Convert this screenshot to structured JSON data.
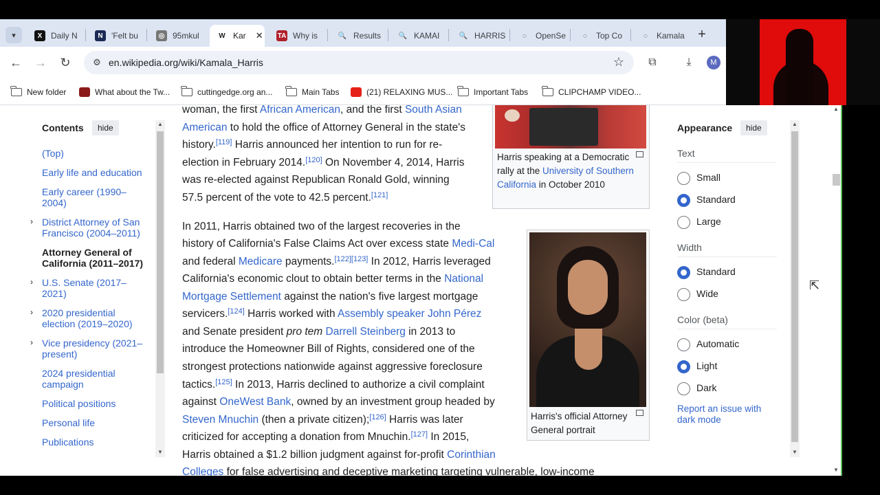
{
  "browser": {
    "tabs": [
      {
        "title": "Daily N",
        "fav_color": "#111111",
        "fav_char": "X"
      },
      {
        "title": "'Felt bu",
        "fav_color": "#1a2a55",
        "fav_char": "N"
      },
      {
        "title": "95mkul",
        "fav_color": "#777777",
        "fav_char": "◎"
      },
      {
        "title": "Kar",
        "fav_color": "#ffffff",
        "fav_char": "W",
        "active": true
      },
      {
        "title": "Why is",
        "fav_color": "#b0202a",
        "fav_char": "TA"
      },
      {
        "title": "Results",
        "fav_color": "#dde5f3",
        "fav_char": "🔍"
      },
      {
        "title": "KAMAI",
        "fav_color": "#dde5f3",
        "fav_char": "🔍"
      },
      {
        "title": "HARRIS",
        "fav_color": "#dde5f3",
        "fav_char": "🔍"
      },
      {
        "title": "OpenSe",
        "fav_color": "#dde5f3",
        "fav_char": "◌"
      },
      {
        "title": "Top Co",
        "fav_color": "#dde5f3",
        "fav_char": "◌"
      },
      {
        "title": "Kamala",
        "fav_color": "#dde5f3",
        "fav_char": "◌"
      }
    ],
    "tab_close": "✕",
    "new_tab": "+",
    "url": "en.wikipedia.org/wiki/Kamala_Harris",
    "avatar": "M",
    "bookmarks": [
      {
        "label": "New folder",
        "type": "folder"
      },
      {
        "label": "What about the Tw...",
        "type": "fav",
        "color": "#8b1a1a"
      },
      {
        "label": "cuttingedge.org an...",
        "type": "folder"
      },
      {
        "label": "Main Tabs",
        "type": "folder"
      },
      {
        "label": "(21) RELAXING MUS...",
        "type": "fav",
        "color": "#e62117"
      },
      {
        "label": "Important Tabs",
        "type": "folder"
      },
      {
        "label": "CLIPCHAMP VIDEO...",
        "type": "folder"
      }
    ]
  },
  "toc": {
    "title": "Contents",
    "hide": "hide",
    "items": [
      {
        "label": "(Top)"
      },
      {
        "label": "Early life and education"
      },
      {
        "label": "Early career (1990–2004)"
      },
      {
        "label": "District Attorney of San Francisco (2004–2011)",
        "chevron": "›"
      },
      {
        "label": "Attorney General of California (2011–2017)",
        "current": true
      },
      {
        "label": "U.S. Senate (2017–2021)",
        "chevron": "›"
      },
      {
        "label": "2020 presidential election (2019–2020)",
        "chevron": "›"
      },
      {
        "label": "Vice presidency (2021–present)",
        "chevron": "›"
      },
      {
        "label": "2024 presidential campaign"
      },
      {
        "label": "Political positions"
      },
      {
        "label": "Personal life"
      },
      {
        "label": "Publications"
      }
    ]
  },
  "article": {
    "p1": {
      "l1a": "woman, the first ",
      "l1b": "African American",
      "l1c": ", and the first ",
      "l1d": "South Asian",
      "l2a": "American",
      "l2b": " to hold the office of Attorney General in the state's",
      "l3a": "history.",
      "l3ref": "[119]",
      "l3b": " Harris announced her intention to run for re-",
      "l4a": "election in February 2014.",
      "l4ref": "[120]",
      "l4b": " On November 4, 2014, Harris",
      "l5": "was re-elected against Republican Ronald Gold, winning",
      "l6a": "57.5 percent of the vote to 42.5 percent.",
      "l6ref": "[121]"
    },
    "p2": {
      "l1": "In 2011, Harris obtained two of the largest recoveries in the",
      "l2a": "history of California's False Claims Act over excess state ",
      "l2b": "Medi-Cal",
      "l3a": "and federal ",
      "l3b": "Medicare",
      "l3c": " payments.",
      "l3ref": "[122][123]",
      "l3d": " In 2012, Harris leveraged",
      "l4a": "California's economic clout to obtain better terms in the ",
      "l4b": "National",
      "l5a": "Mortgage Settlement",
      "l5b": " against the nation's five largest mortgage",
      "l6a": "servicers.",
      "l6ref": "[124]",
      "l6b": " Harris worked with ",
      "l6c": "Assembly speaker John Pérez",
      "l7a": "and Senate president ",
      "l7b": "pro tem",
      "l7c": " ",
      "l7d": "Darrell Steinberg",
      "l7e": " in 2013 to",
      "l8": "introduce the Homeowner Bill of Rights, considered one of the",
      "l9": "strongest protections nationwide against aggressive foreclosure",
      "l10a": "tactics.",
      "l10ref": "[125]",
      "l10b": " In 2013, Harris declined to authorize a civil complaint",
      "l11a": "against ",
      "l11b": "OneWest Bank",
      "l11c": ", owned by an investment group headed by",
      "l12a": "Steven Mnuchin",
      "l12b": " (then a private citizen);",
      "l12ref": "[126]",
      "l12c": " Harris was later",
      "l13a": "criticized for accepting a donation from Mnuchin.",
      "l13ref": "[127]",
      "l13b": " In 2015,",
      "l14a": "Harris obtained a $1.2 billion judgment against for-profit ",
      "l14b": "Corinthian",
      "l15a": "Colleges",
      "l15b": " for false advertising and deceptive marketing targeting vulnerable, low-income"
    },
    "fig1_caption": {
      "a": "Harris speaking at a Democratic rally at the ",
      "b": "University of Southern California",
      "c": " in October 2010"
    },
    "fig2_caption": "Harris's official Attorney General portrait"
  },
  "appearance": {
    "title": "Appearance",
    "hide": "hide",
    "text_label": "Text",
    "text_options": [
      "Small",
      "Standard",
      "Large"
    ],
    "text_selected": "Standard",
    "width_label": "Width",
    "width_options": [
      "Standard",
      "Wide"
    ],
    "width_selected": "Standard",
    "color_label": "Color (beta)",
    "color_options": [
      "Automatic",
      "Light",
      "Dark"
    ],
    "color_selected": "Light",
    "report_link": "Report an issue with dark mode"
  }
}
